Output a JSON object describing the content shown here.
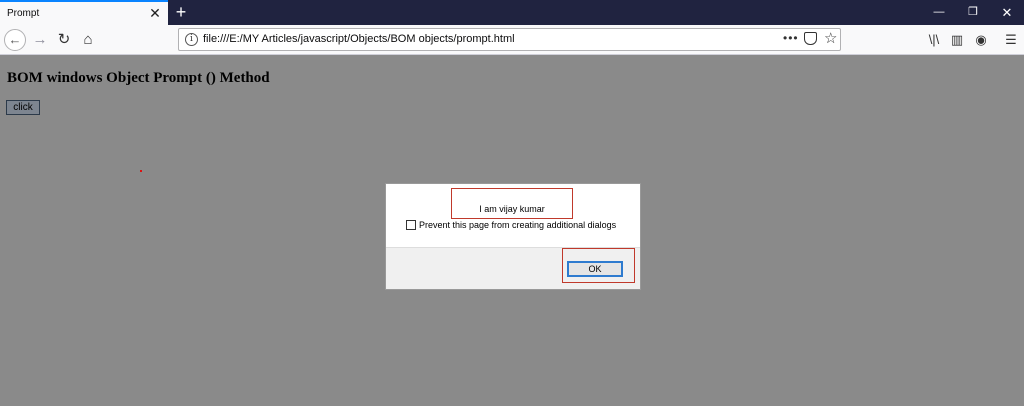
{
  "browser": {
    "tab_title": "Prompt",
    "tab_close": "✕",
    "new_tab": "+",
    "window": {
      "minimize": "—",
      "maximize": "❐",
      "close": "✕"
    },
    "nav": {
      "back": "←",
      "forward": "→",
      "reload": "↻",
      "home": "⌂"
    },
    "url": "file:///E:/MY Articles/javascript/Objects/BOM objects/prompt.html",
    "url_info": "i",
    "url_more": "•••",
    "url_star": "☆",
    "toolbar": {
      "library": "\\|\\",
      "sidebar": "▥",
      "account": "◉",
      "menu": "☰"
    }
  },
  "page": {
    "heading": "BOM windows Object Prompt () Method",
    "button_label": "click"
  },
  "dialog": {
    "message": "I am vijay kumar",
    "checkbox_label": "Prevent this page from creating additional dialogs",
    "ok_label": "OK"
  },
  "colors": {
    "overlay": "#8a8a8a",
    "tab_strip": "#202340",
    "accent": "#0a84ff",
    "highlight": "#c0392b"
  }
}
